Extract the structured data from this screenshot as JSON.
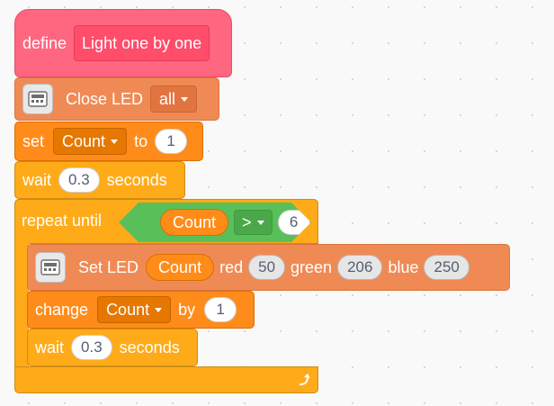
{
  "define_block": {
    "keyword": "define",
    "name": "Light one by one"
  },
  "close_led": {
    "label": "Close LED",
    "option": "all",
    "icon": "robot-board-icon"
  },
  "set_var": {
    "keyword": "set",
    "variable": "Count",
    "to_label": "to",
    "value": "1"
  },
  "wait1": {
    "keyword": "wait",
    "value": "0.3",
    "unit": "seconds"
  },
  "repeat_until": {
    "keyword": "repeat until",
    "condition": {
      "left": "Count",
      "operator": ">",
      "right": "6"
    }
  },
  "set_led": {
    "label": "Set LED",
    "index_var": "Count",
    "red_label": "red",
    "red": "50",
    "green_label": "green",
    "green": "206",
    "blue_label": "blue",
    "blue": "250",
    "icon": "robot-board-icon"
  },
  "change_var": {
    "keyword": "change",
    "variable": "Count",
    "by_label": "by",
    "value": "1"
  },
  "wait2": {
    "keyword": "wait",
    "value": "0.3",
    "unit": "seconds"
  },
  "loop_end": {
    "icon": "loop-arrow-icon"
  },
  "colors": {
    "procedure": "#ff6680",
    "extension": "#f08a55",
    "variables": "#ff8c1a",
    "control": "#ffab19",
    "operators": "#59c059"
  }
}
